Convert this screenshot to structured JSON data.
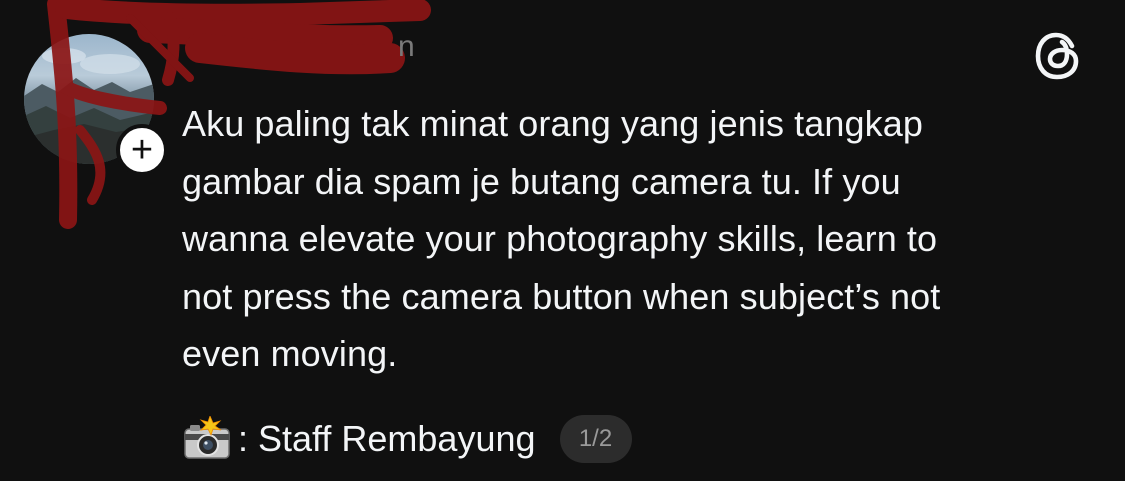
{
  "post": {
    "author": {
      "username_visible_fragment": "n",
      "follow_badge_label": "+"
    },
    "text": "Aku paling tak minat orang yang jenis tangkap\ngambar dia spam je butang camera tu. If you\nwanna elevate your photography skills, learn to\nnot press the camera button when subject’s not\neven moving.",
    "credit": {
      "icon": "camera-with-flash-icon",
      "text": ": Staff Rembayung"
    },
    "media_indicator": "1/2"
  },
  "app": {
    "logo_icon": "threads-logo-icon"
  },
  "colors": {
    "background": "#101010",
    "text": "#f3f5f7",
    "muted": "#7a7a7a",
    "pill": "#2c2c2c",
    "redaction": "#8b1515"
  }
}
